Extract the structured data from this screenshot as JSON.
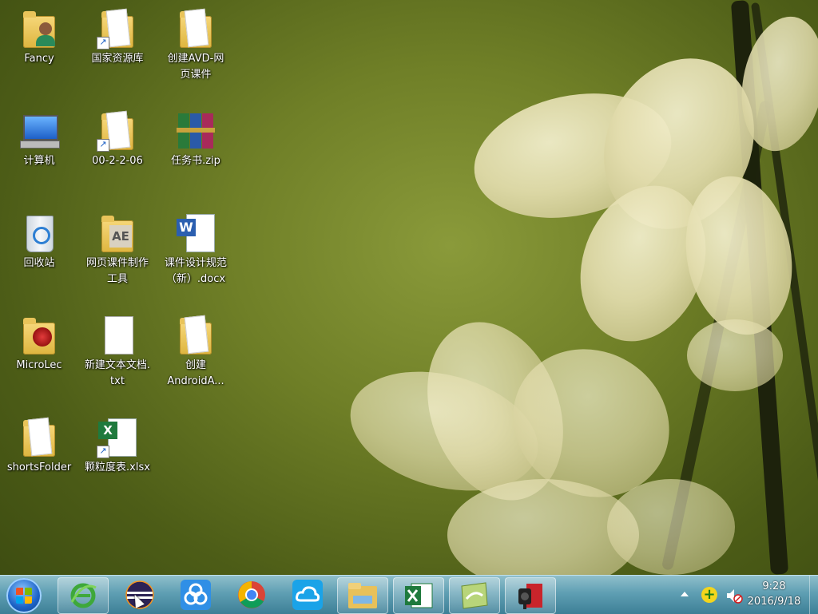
{
  "desktop": {
    "icons": [
      {
        "label": "Fancy",
        "icon": "user-folder-icon"
      },
      {
        "label": "国家资源库",
        "icon": "folder-shortcut-icon"
      },
      {
        "label": "创建AVD-网\n页课件",
        "icon": "folder-icon"
      },
      {
        "label": "计算机",
        "icon": "computer-icon"
      },
      {
        "label": "00-2-2-06",
        "icon": "folder-shortcut-icon"
      },
      {
        "label": "任务书.zip",
        "icon": "winrar-archive-icon"
      },
      {
        "label": "回收站",
        "icon": "recycle-bin-icon"
      },
      {
        "label": "网页课件制作\n工具",
        "icon": "ae-folder-icon"
      },
      {
        "label": "课件设计规范\n（新）.docx",
        "icon": "word-document-icon"
      },
      {
        "label": "MicroLec",
        "icon": "microlec-folder-icon"
      },
      {
        "label": "新建文本文档.\ntxt",
        "icon": "text-document-icon"
      },
      {
        "label": "创建\nAndroidA...",
        "icon": "folder-icon"
      },
      {
        "label": "shortsFolder",
        "icon": "folder-icon"
      },
      {
        "label": "颗粒度表.xlsx",
        "icon": "excel-shortcut-icon"
      }
    ]
  },
  "taskbar": {
    "start_icon": "windows-start-icon",
    "apps": [
      {
        "icon": "ie-browser-icon"
      },
      {
        "icon": "eclipse-icon"
      },
      {
        "icon": "baidu-cloud-icon"
      },
      {
        "icon": "chrome-icon"
      },
      {
        "icon": "cloud-sync-icon"
      },
      {
        "icon": "file-explorer-icon"
      },
      {
        "icon": "excel-icon"
      },
      {
        "icon": "presentation-app-icon"
      },
      {
        "icon": "screen-recorder-icon"
      }
    ],
    "tray": {
      "time": "9:28",
      "date": "2016/9/18",
      "icons": [
        "show-hidden-icons-chevron",
        "network-plus-icon",
        "volume-muted-icon"
      ]
    }
  }
}
